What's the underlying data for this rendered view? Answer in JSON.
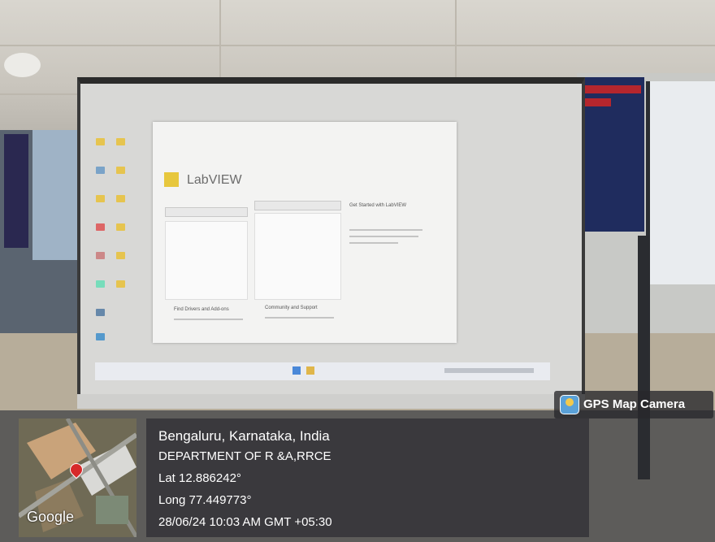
{
  "overlay": {
    "location": "Bengaluru, Karnataka, India",
    "department": "DEPARTMENT OF R &A,RRCE",
    "lat": "Lat 12.886242°",
    "long": "Long 77.449773°",
    "datetime": "28/06/24 10:03 AM GMT +05:30"
  },
  "badge": {
    "label": "GPS Map Camera"
  },
  "map": {
    "provider": "Google"
  },
  "projected": {
    "app_title": "LabVIEW",
    "get_started": "Get Started with LabVIEW",
    "find_drivers": "Find Drivers and Add-ons",
    "community": "Community and Support"
  },
  "icons": {
    "gps": "gps-camera-icon",
    "pin": "map-pin-icon"
  },
  "colors": {
    "overlay_bg": "#2d2d32",
    "banner": "#1f2c5e",
    "pin": "#d72a2a"
  }
}
